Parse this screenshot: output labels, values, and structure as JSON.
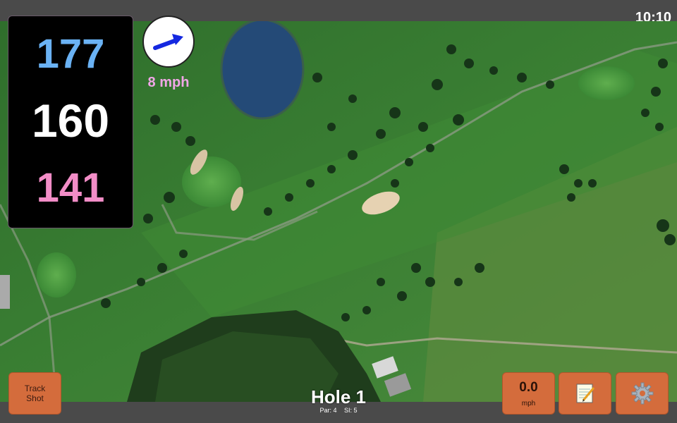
{
  "status_bar": {
    "time": "10:10"
  },
  "distances": {
    "back": "177",
    "middle": "160",
    "front": "141"
  },
  "wind": {
    "speed": "8 mph",
    "icon": "wind-direction-arrow-icon"
  },
  "buttons": {
    "track_shot": {
      "line1": "Track",
      "line2": "Shot"
    },
    "speed": {
      "value": "0.0",
      "unit": "mph"
    },
    "notes": {
      "icon": "notepad-icon"
    },
    "settings": {
      "icon": "gear-icon"
    }
  },
  "hole": {
    "title": "Hole 1",
    "par": "Par: 4",
    "si": "SI: 5"
  },
  "colors": {
    "back": "#6ab2f4",
    "middle": "#ffffff",
    "front": "#f28dc7",
    "button": "#d46c3c",
    "wind_text": "#f0a6e6"
  }
}
